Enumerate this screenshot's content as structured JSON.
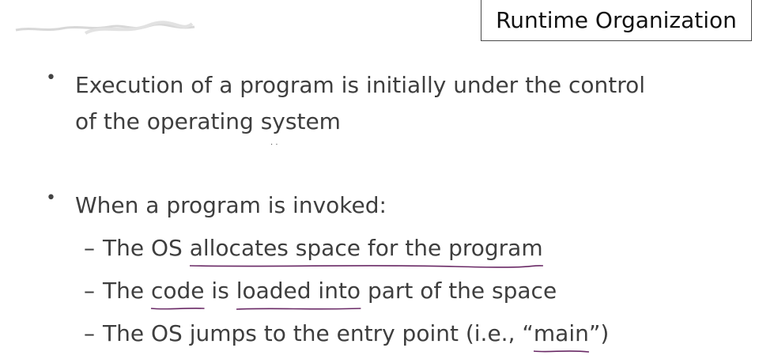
{
  "slide": {
    "title": "Runtime Organization",
    "bullet_marker": "•",
    "sub_marker": "–",
    "bullet1": {
      "line1": "Execution of a program is initially under the control",
      "line2": "of the operating system"
    },
    "bullet2": {
      "line1": "When a program is invoked:"
    },
    "sub1": {
      "prefix": "The OS ",
      "underlined": "allocates space for the program",
      "suffix": ""
    },
    "sub2": {
      "prefix": "The ",
      "underlined1": "code",
      "middle": " is ",
      "underlined2": "loaded into",
      "suffix": " part of the space"
    },
    "sub3": {
      "prefix": "The OS jumps to the entry point (i.e., ",
      "open_quote": "“",
      "underlined": "main",
      "close_quote": "”",
      "suffix": ")"
    }
  },
  "colors": {
    "text": "#3e3e3e",
    "title_text": "#111111",
    "title_border": "#4a4a4a",
    "ink": "#6a2a66",
    "background": "#ffffff"
  }
}
